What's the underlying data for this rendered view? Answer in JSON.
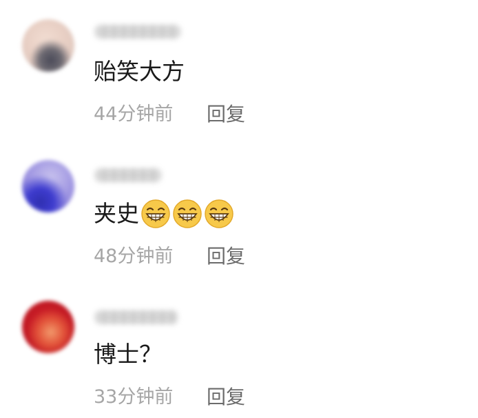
{
  "comments": [
    {
      "text": "贻笑大方",
      "emoji_count": 0,
      "time": "44分钟前",
      "reply_label": "回复"
    },
    {
      "text": "夹史",
      "emoji_count": 3,
      "emoji_icon": "grinning-face-icon",
      "time": "48分钟前",
      "reply_label": "回复"
    },
    {
      "text": "博士？",
      "emoji_count": 0,
      "time": "33分钟前",
      "reply_label": "回复"
    }
  ],
  "colors": {
    "comment_text": "#1a1a1a",
    "timestamp": "#a6a6a6",
    "reply": "#6b6b6b",
    "emoji_face": "#f7c94a"
  }
}
